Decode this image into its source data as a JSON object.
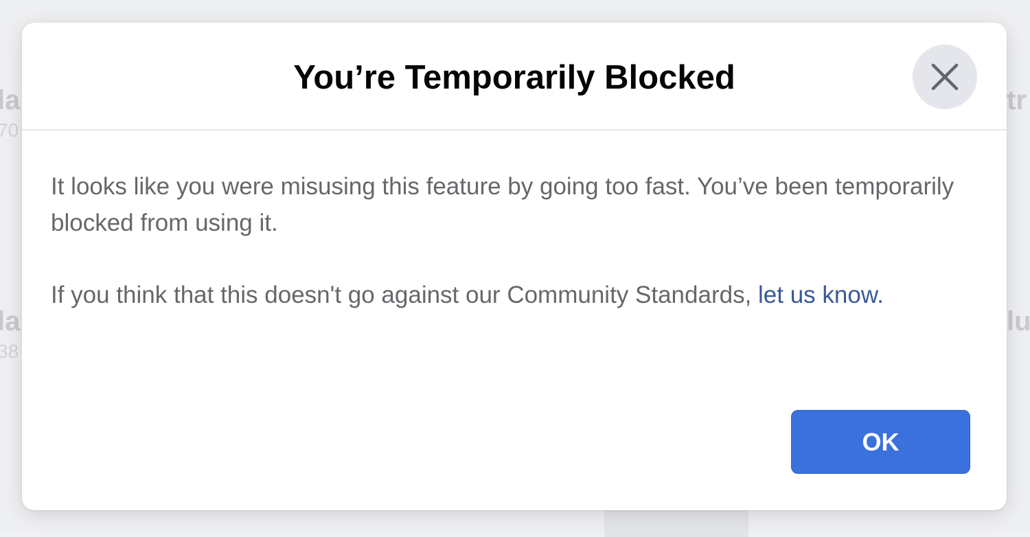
{
  "background": {
    "fragments": [
      "la",
      "70",
      "tr",
      "la",
      "38",
      "lu"
    ]
  },
  "dialog": {
    "title": "You’re Temporarily Blocked",
    "close_icon": "close-icon",
    "body": {
      "paragraph1": "It looks like you were misusing this feature by going too fast. You’ve been temporarily blocked from using it.",
      "paragraph2_prefix": "If you think that this doesn't go against our Community Standards, ",
      "link_text": "let us know",
      "paragraph2_suffix": "."
    },
    "ok_label": "OK"
  },
  "colors": {
    "primary_button": "#3a71dc",
    "link": "#385898",
    "body_text": "#65676b",
    "title_text": "#050505"
  }
}
